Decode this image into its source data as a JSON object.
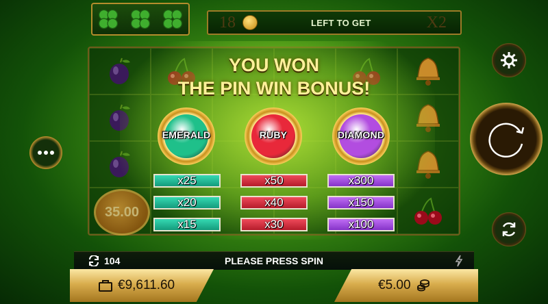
{
  "top": {
    "clover_count": 3,
    "left_count": "18",
    "left_label": "LEFT TO GET",
    "multiplier": "X2"
  },
  "reels": {
    "symbols": [
      [
        "plum",
        "cherry",
        "none",
        "none",
        "cherry",
        "bell"
      ],
      [
        "plum",
        "none",
        "none",
        "none",
        "none",
        "bell"
      ],
      [
        "plum",
        "none",
        "none",
        "none",
        "none",
        "bell"
      ],
      [
        "coin",
        "none",
        "none",
        "none",
        "none",
        "cherry"
      ]
    ],
    "bonus_coin_value": "35.00"
  },
  "win": {
    "line1": "YOU WON",
    "line2": "THE PIN WIN BONUS!",
    "gems": [
      {
        "label": "EMERALD",
        "color": "#1fc08a",
        "multipliers": [
          "x25",
          "x20",
          "x15"
        ]
      },
      {
        "label": "RUBY",
        "color": "#e8283a",
        "multipliers": [
          "x50",
          "x40",
          "x30"
        ]
      },
      {
        "label": "DIAMOND",
        "color": "#b24de0",
        "multipliers": [
          "x300",
          "x150",
          "x100"
        ]
      }
    ]
  },
  "status": {
    "spins": "104",
    "message": "PLEASE PRESS SPIN"
  },
  "balance": "€9,611.60",
  "bet": "€5.00",
  "colors": {
    "gold": "#d9ad4d",
    "board_green": "#135208"
  }
}
